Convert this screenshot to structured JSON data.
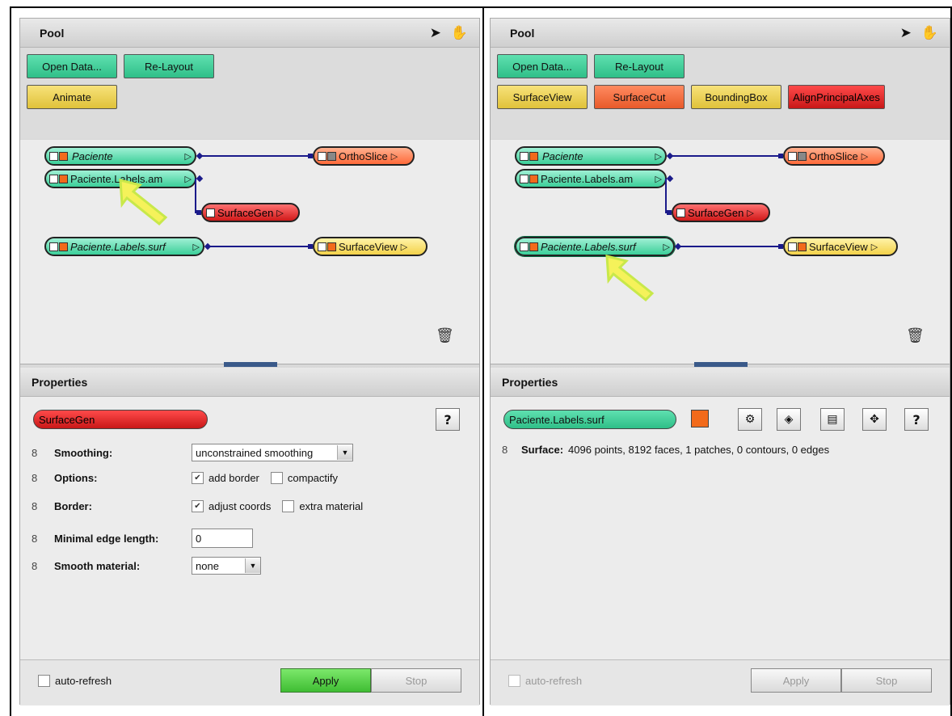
{
  "left": {
    "pool_title": "Pool",
    "buttons_row1": [
      "Open Data...",
      "Re-Layout"
    ],
    "buttons_row2": [
      "Animate"
    ],
    "nodes": {
      "paciente": "Paciente",
      "labels_am": "Paciente.Labels.am",
      "labels_surf": "Paciente.Labels.surf",
      "orthoslice": "OrthoSlice",
      "surfacegen": "SurfaceGen",
      "surfaceview": "SurfaceView"
    },
    "properties_title": "Properties",
    "module_name": "SurfaceGen",
    "help": "?",
    "props": {
      "smoothing_label": "Smoothing:",
      "smoothing_value": "unconstrained smoothing",
      "options_label": "Options:",
      "opt_add_border": "add border",
      "opt_compactify": "compactify",
      "border_label": "Border:",
      "border_adjust": "adjust coords",
      "border_extra": "extra material",
      "min_edge_label": "Minimal edge length:",
      "min_edge_value": "0",
      "smooth_mat_label": "Smooth material:",
      "smooth_mat_value": "none"
    },
    "auto_refresh": "auto-refresh",
    "apply": "Apply",
    "stop": "Stop"
  },
  "right": {
    "pool_title": "Pool",
    "buttons_row1": [
      "Open Data...",
      "Re-Layout"
    ],
    "buttons_row2": [
      "SurfaceView",
      "SurfaceCut",
      "BoundingBox",
      "AlignPrincipalAxes"
    ],
    "nodes": {
      "paciente": "Paciente",
      "labels_am": "Paciente.Labels.am",
      "labels_surf": "Paciente.Labels.surf",
      "orthoslice": "OrthoSlice",
      "surfacegen": "SurfaceGen",
      "surfaceview": "SurfaceView"
    },
    "properties_title": "Properties",
    "module_name": "Paciente.Labels.surf",
    "help": "?",
    "surface_label": "Surface:",
    "surface_value": "4096 points, 8192 faces, 1 patches, 0 contours, 0 edges",
    "auto_refresh": "auto-refresh",
    "apply": "Apply",
    "stop": "Stop"
  },
  "icons": {
    "pointer": "arrow-pointer-icon",
    "hand": "hand-icon",
    "trash": "trash-icon",
    "pin": "pin-icon"
  },
  "colors": {
    "green": "#3ccf99",
    "yellow": "#f3d24a",
    "orange": "#ff6a3a",
    "red": "#d01a1a",
    "apply_green": "#3fbd33"
  }
}
